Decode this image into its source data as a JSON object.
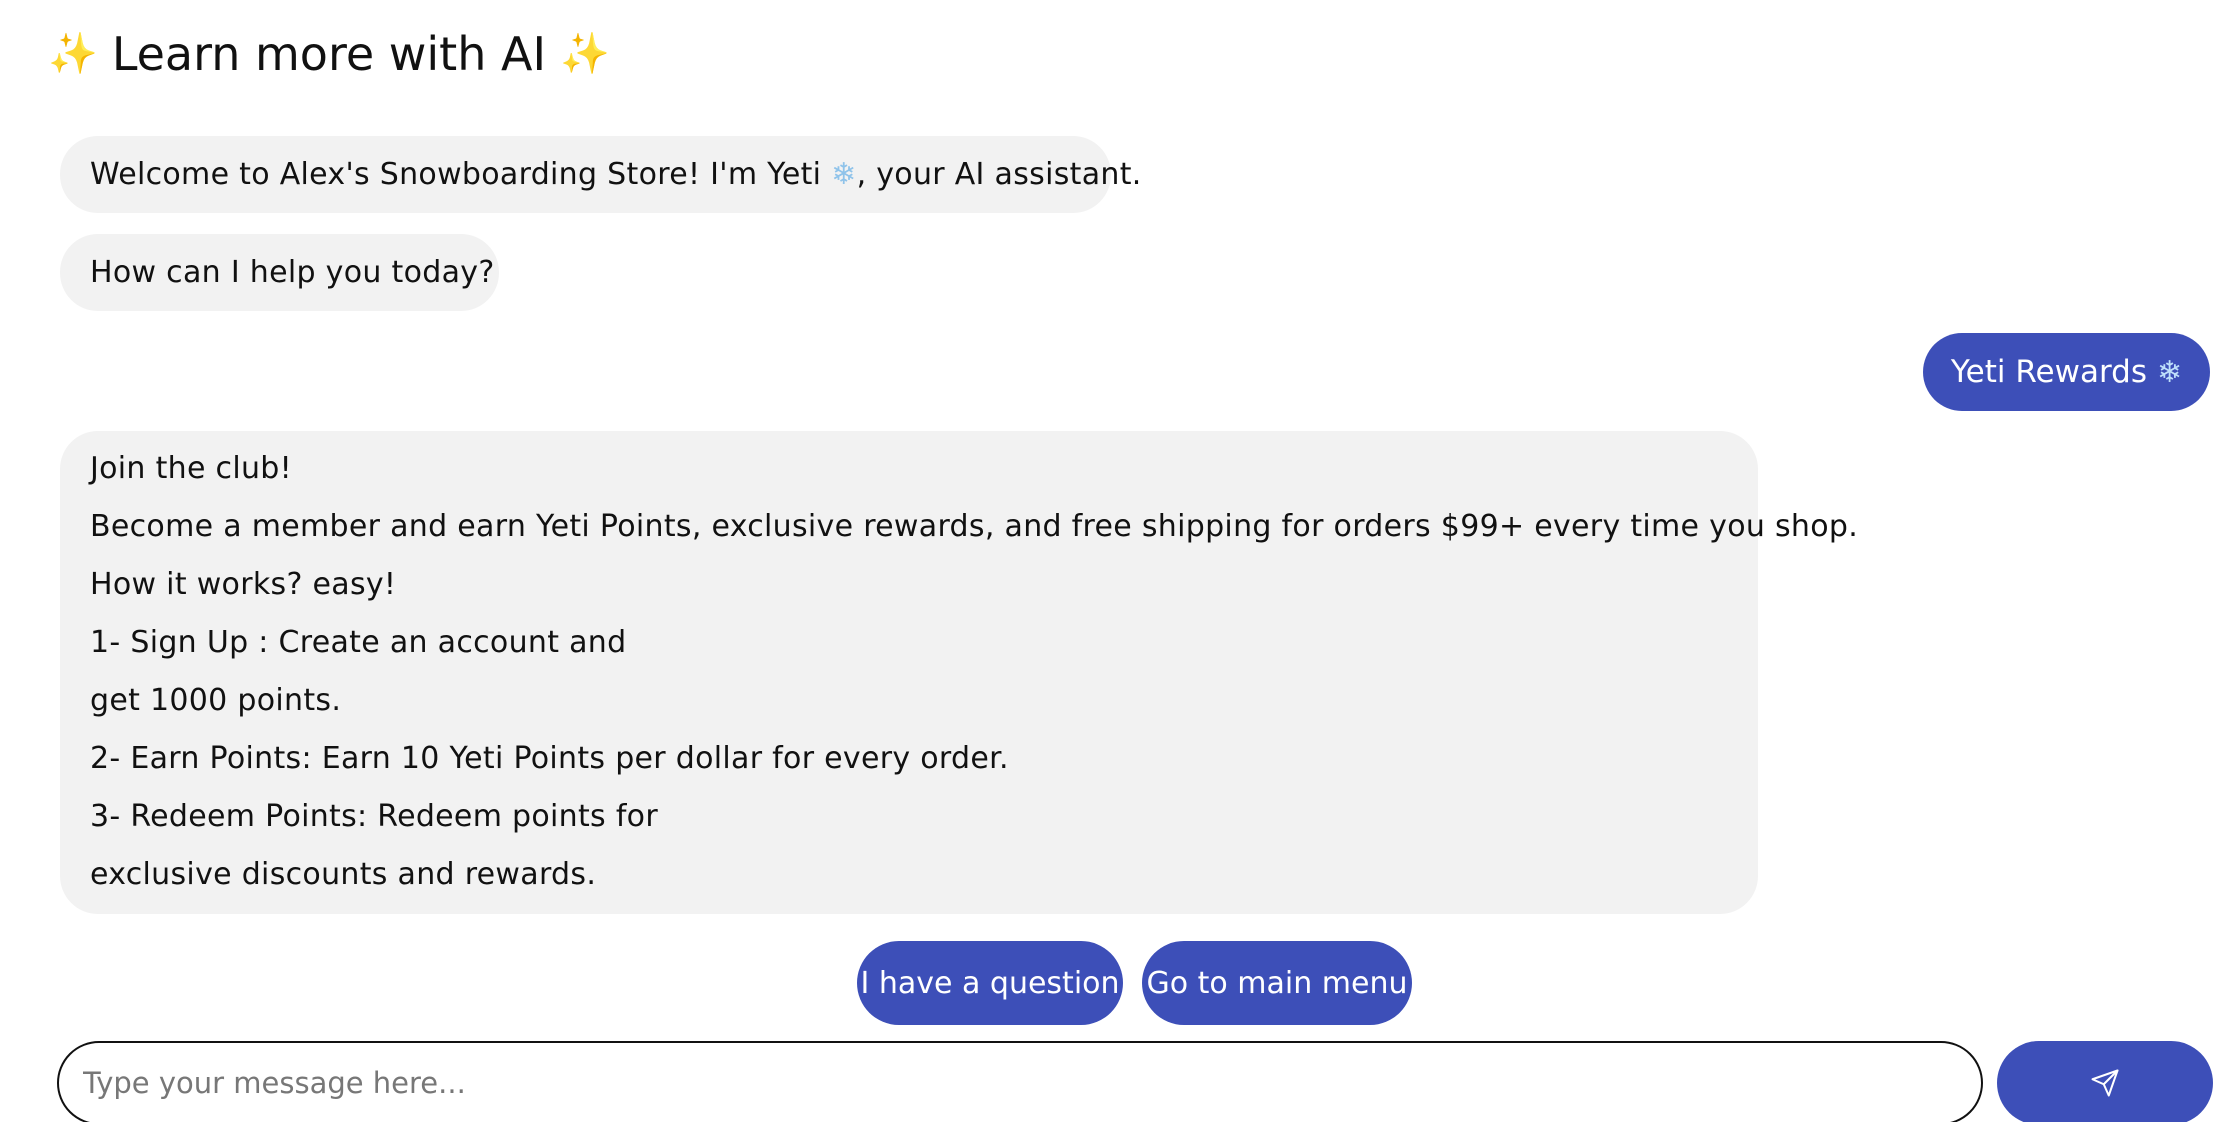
{
  "header": {
    "sparkle_left": "✨",
    "title": "Learn more with AI",
    "sparkle_right": "✨"
  },
  "messages": {
    "bot_welcome": {
      "before": "Welcome to Alex's Snowboarding Store! I'm Yeti ",
      "emoji": "❄",
      "after": ", your AI assistant."
    },
    "bot_help": "How can I help you today?",
    "user_choice": {
      "label": "Yeti Rewards",
      "emoji": "❄"
    },
    "bot_rewards_lines": [
      "Join the club!",
      "Become a member and earn Yeti Points, exclusive rewards, and free shipping for orders $99+ every time you shop.",
      "How it works? easy!",
      "1- Sign Up : Create an account and",
      "get 1000 points.",
      "2- Earn Points: Earn 10 Yeti Points per dollar for every order.",
      "3- Redeem Points: Redeem points for",
      "exclusive discounts and rewards."
    ]
  },
  "quick_replies": [
    "I have a question",
    "Go to main menu"
  ],
  "composer": {
    "placeholder": "Type your message here...",
    "send_icon": "send-icon"
  },
  "colors": {
    "accent": "#3d4fb8",
    "bot_bubble": "#f2f2f2"
  }
}
